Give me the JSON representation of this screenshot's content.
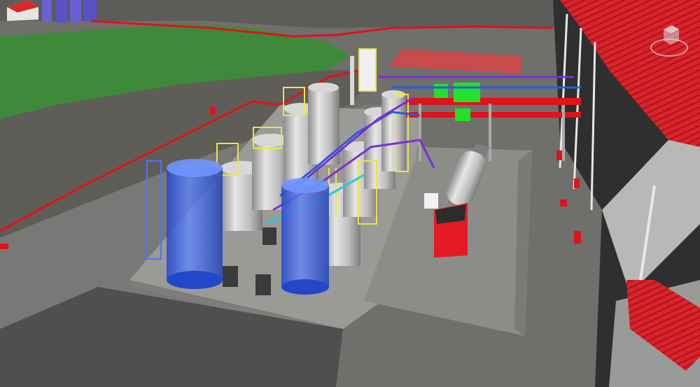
{
  "scene": {
    "colors": {
      "grass": "#3f8a3a",
      "ground": "#6f6f6c",
      "ground_dark": "#565656",
      "slab": "#9a9a97",
      "fence": "#e0121b",
      "roof": "#d9232b",
      "building_wall": "#2f2f2f",
      "tank_steel": "#bdbdbd",
      "tank_blue": "#3e64e6",
      "ladder": "#e8e64a",
      "pipe_purple": "#7a2fd6",
      "pipe_blue": "#2b5bd8",
      "pipe_green": "#23e02b",
      "truck_cab": "#e41b22",
      "canopy": "#e54040"
    }
  },
  "nav_cube": {
    "icon": "view-cube-icon"
  }
}
